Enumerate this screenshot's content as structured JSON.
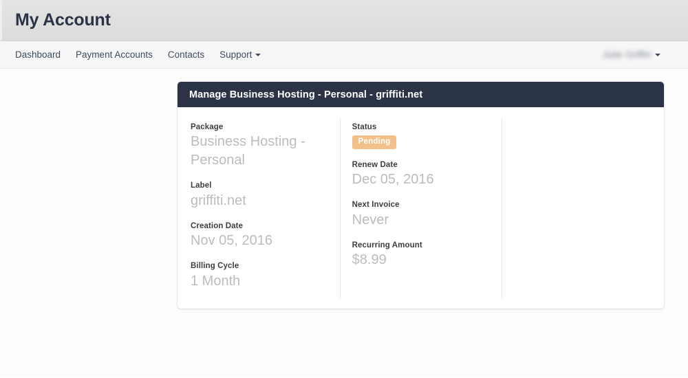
{
  "header": {
    "title": "My Account"
  },
  "nav": {
    "items": [
      {
        "label": "Dashboard",
        "has_caret": false
      },
      {
        "label": "Payment Accounts",
        "has_caret": false
      },
      {
        "label": "Contacts",
        "has_caret": false
      },
      {
        "label": "Support",
        "has_caret": true
      }
    ],
    "user_menu": {
      "name": "Julie Griffin",
      "redacted": true,
      "caret_icon": "chevron-down-icon"
    }
  },
  "panel": {
    "title": "Manage Business Hosting - Personal - griffiti.net",
    "columns": [
      {
        "fields": [
          {
            "label": "Package",
            "value": "Business Hosting - Personal",
            "type": "text"
          },
          {
            "label": "Label",
            "value": "griffiti.net",
            "type": "text"
          },
          {
            "label": "Creation Date",
            "value": "Nov 05, 2016",
            "type": "text"
          },
          {
            "label": "Billing Cycle",
            "value": "1 Month",
            "type": "text"
          }
        ]
      },
      {
        "fields": [
          {
            "label": "Status",
            "value": "Pending",
            "type": "badge"
          },
          {
            "label": "Renew Date",
            "value": "Dec 05, 2016",
            "type": "text"
          },
          {
            "label": "Next Invoice",
            "value": "Never",
            "type": "text"
          },
          {
            "label": "Recurring Amount",
            "value": "$8.99",
            "type": "text"
          }
        ]
      },
      {
        "fields": []
      }
    ]
  },
  "colors": {
    "header_bg": "#dcdcdc",
    "navbar_bg": "#f7f7f7",
    "panel_heading_bg": "#2b3446",
    "badge_pending_bg": "#f2c18a",
    "field_value_color": "#bcbcbc",
    "page_bg": "#fdfdfd"
  }
}
